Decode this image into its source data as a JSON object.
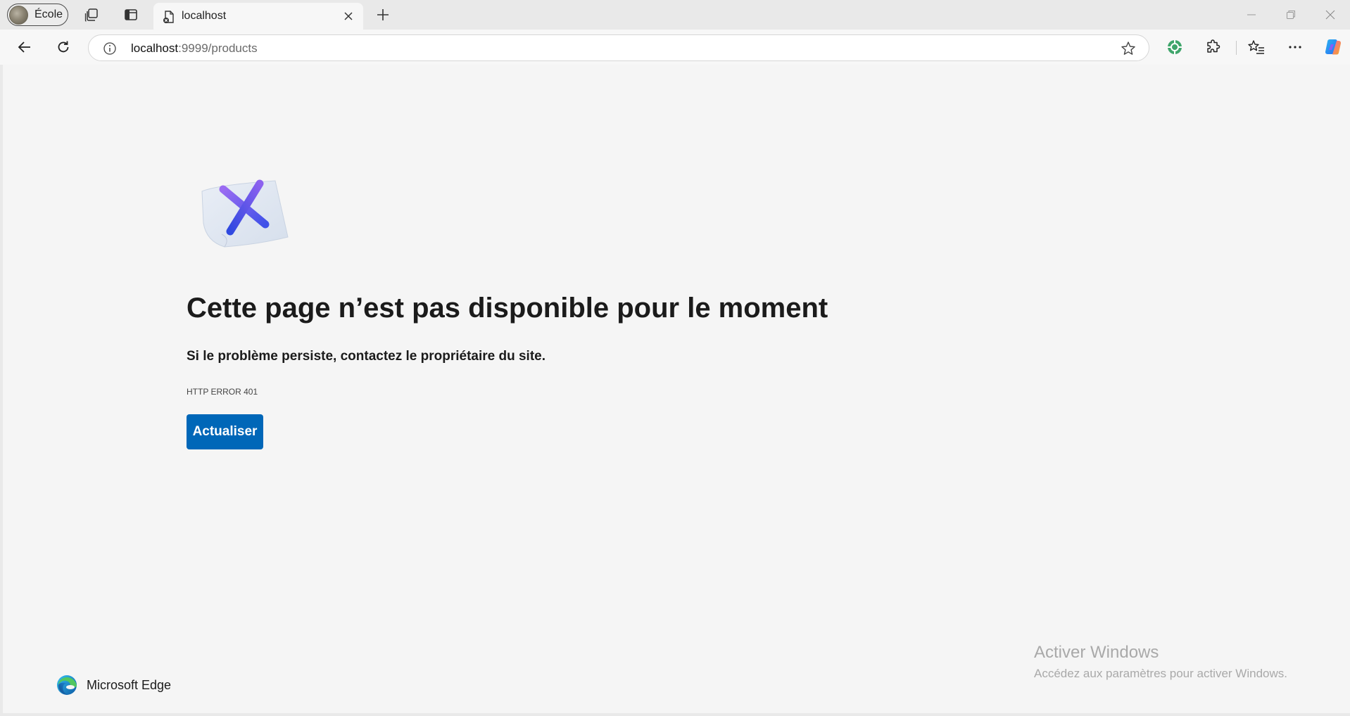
{
  "profile": {
    "label": "École"
  },
  "tab": {
    "title": "localhost",
    "favicon": "page-error-icon"
  },
  "address": {
    "host": "localhost",
    "path": ":9999/products"
  },
  "icons": {
    "workspaces": "workspaces-icon",
    "vertical_tabs": "vertical-tabs-icon",
    "new_tab": "plus-icon",
    "back": "back-arrow-icon",
    "reload": "reload-icon",
    "site_info": "info-icon",
    "favorite": "star-icon",
    "extension1": "green-extension-icon",
    "extensions": "puzzle-icon",
    "favorites": "favorites-list-icon",
    "more": "more-icon",
    "copilot": "copilot-icon"
  },
  "error": {
    "title": "Cette page n’est pas disponible pour le moment",
    "subtitle": "Si le problème persiste, contactez le propriétaire du site.",
    "code": "HTTP ERROR 401",
    "button": "Actualiser"
  },
  "brand": {
    "name": "Microsoft Edge"
  },
  "watermark": {
    "title": "Activer Windows",
    "subtitle": "Accédez aux paramètres pour activer Windows."
  },
  "colors": {
    "accent": "#0067b8",
    "page_bg": "#f5f5f5",
    "chrome_bg": "#e9e9e9"
  }
}
